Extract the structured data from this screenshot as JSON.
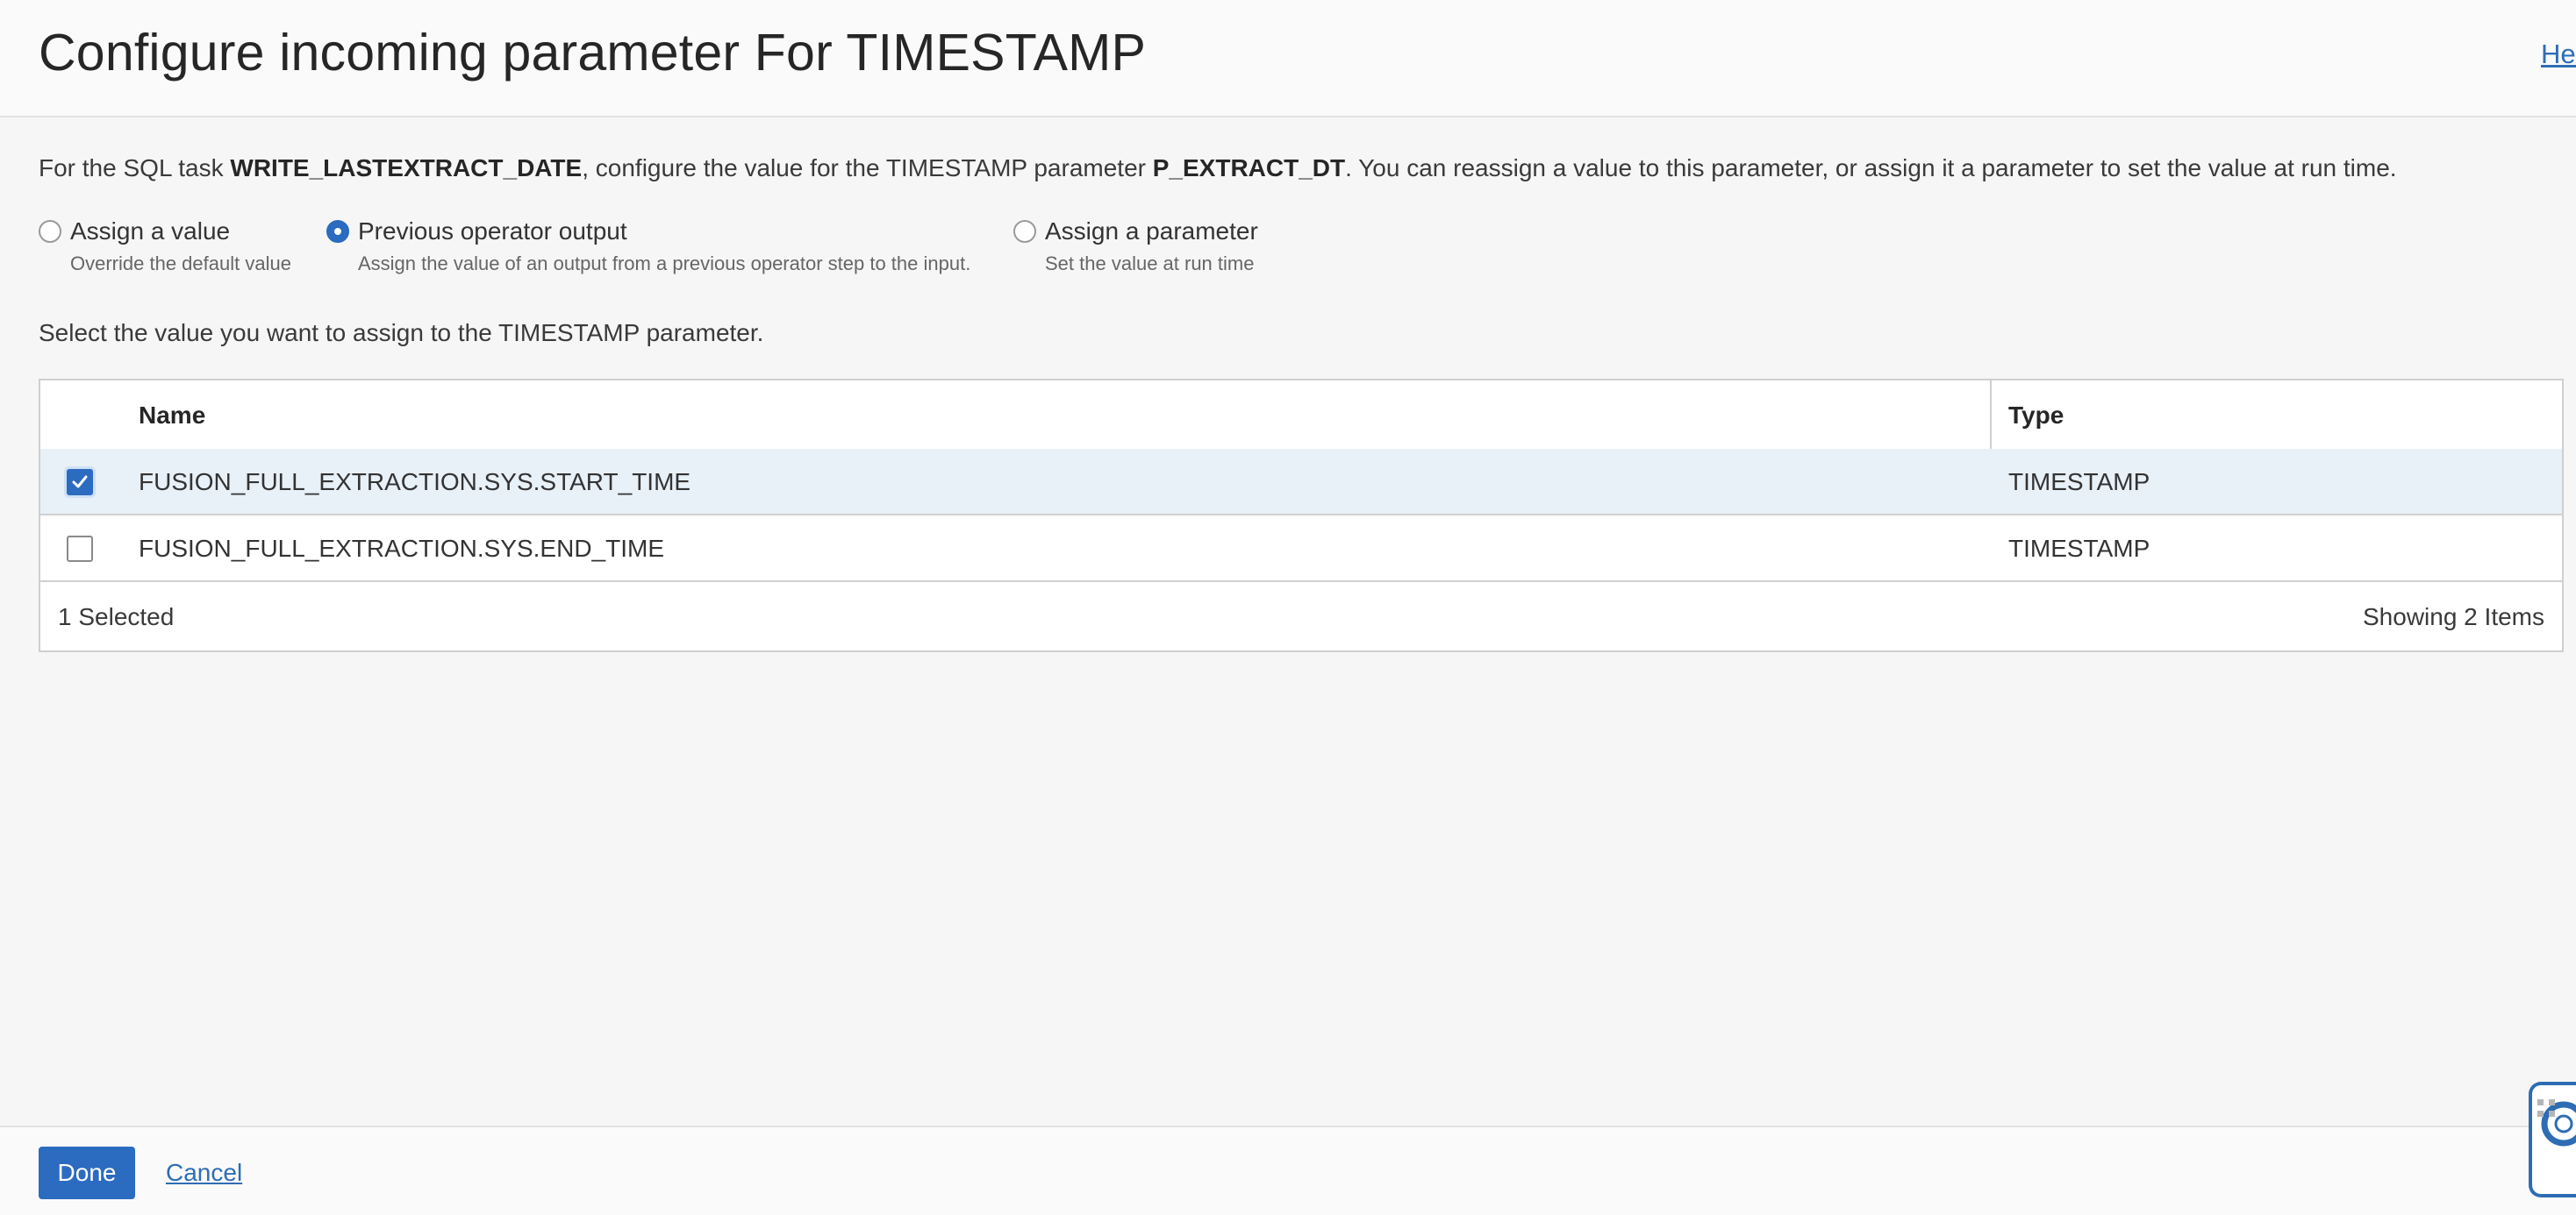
{
  "header": {
    "title": "Configure incoming parameter For TIMESTAMP",
    "help_label": "Help"
  },
  "intro": {
    "prefix": "For the SQL task ",
    "task_name": "WRITE_LASTEXTRACT_DATE",
    "middle": ", configure the value for the TIMESTAMP parameter ",
    "param_name": "P_EXTRACT_DT",
    "suffix": ". You can reassign a value to this parameter, or assign it a parameter to set the value at run time."
  },
  "options": [
    {
      "label": "Assign a value",
      "description": "Override the default value",
      "selected": false
    },
    {
      "label": "Previous operator output",
      "description": "Assign the value of an output from a previous operator step to the input.",
      "selected": true
    },
    {
      "label": "Assign a parameter",
      "description": "Set the value at run time",
      "selected": false
    }
  ],
  "instruction": "Select the value you want to assign to the TIMESTAMP parameter.",
  "table": {
    "columns": [
      "Name",
      "Type"
    ],
    "rows": [
      {
        "name": "FUSION_FULL_EXTRACTION.SYS.START_TIME",
        "type": "TIMESTAMP",
        "checked": true
      },
      {
        "name": "FUSION_FULL_EXTRACTION.SYS.END_TIME",
        "type": "TIMESTAMP",
        "checked": false
      }
    ],
    "footer_left": "1 Selected",
    "footer_right": "Showing 2 Items"
  },
  "actions": {
    "done_label": "Done",
    "cancel_label": "Cancel"
  },
  "colors": {
    "accent": "#2b6bc0",
    "link": "#2e6db4",
    "selected_row": "#e8f0f8"
  },
  "icons": [
    "check-icon",
    "lifebuoy-icon",
    "grip-icon"
  ]
}
